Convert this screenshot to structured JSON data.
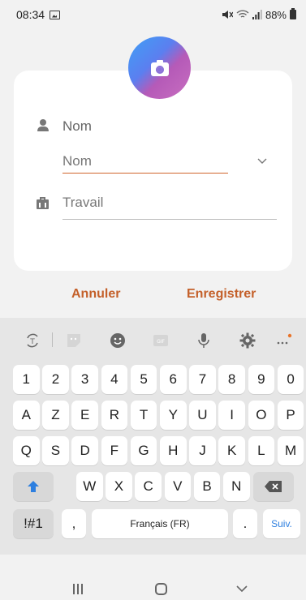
{
  "status_bar": {
    "time": "08:34",
    "battery": "88%"
  },
  "form": {
    "name_label": "Nom",
    "name_placeholder": "Nom",
    "work_placeholder": "Travail"
  },
  "actions": {
    "cancel_label": "Annuler",
    "save_label": "Enregistrer"
  },
  "keyboard": {
    "toolbar_icons": [
      "translate-icon",
      "sticker-icon",
      "emoji-icon",
      "gif-icon",
      "mic-icon",
      "settings-icon",
      "more-icon"
    ],
    "row_numbers": [
      "1",
      "2",
      "3",
      "4",
      "5",
      "6",
      "7",
      "8",
      "9",
      "0"
    ],
    "row_1": [
      "A",
      "Z",
      "E",
      "R",
      "T",
      "Y",
      "U",
      "I",
      "O",
      "P"
    ],
    "row_2": [
      "Q",
      "S",
      "D",
      "F",
      "G",
      "H",
      "J",
      "K",
      "L",
      "M"
    ],
    "row_3": [
      "W",
      "X",
      "C",
      "V",
      "B",
      "N"
    ],
    "symbols_key": "!#1",
    "comma_key": ",",
    "space_key": "Français (FR)",
    "period_key": ".",
    "next_key": "Suiv."
  },
  "colors": {
    "accent": "#c4602a",
    "keyboard_bg": "#e6e6e6",
    "shift_blue": "#2d7fe0"
  }
}
